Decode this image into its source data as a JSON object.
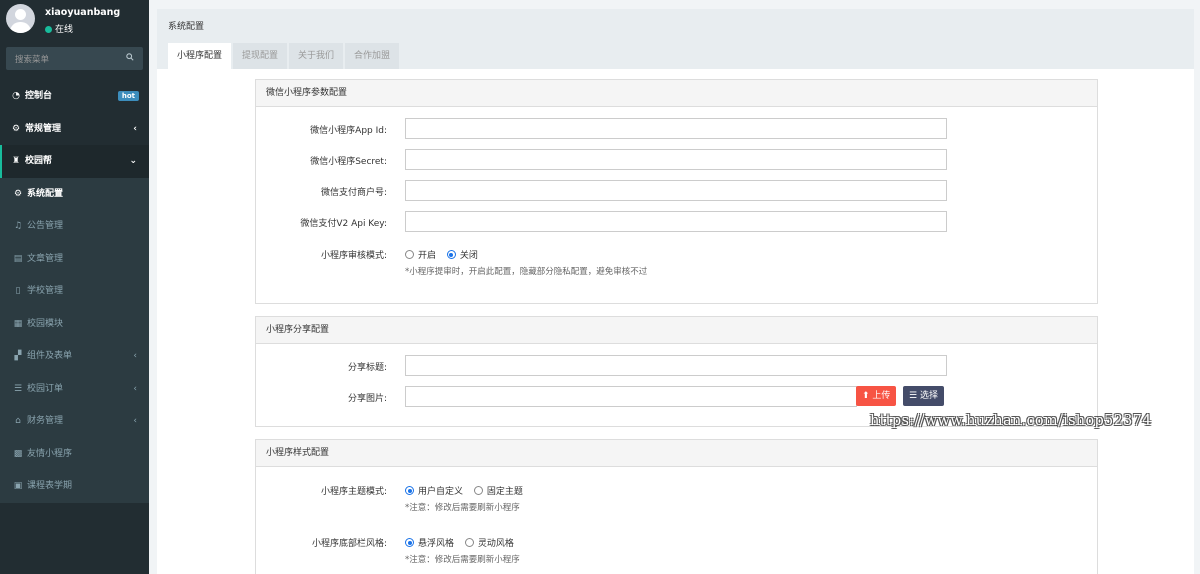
{
  "user": {
    "name": "xiaoyuanbang",
    "status": "在线"
  },
  "search": {
    "placeholder": "搜索菜单"
  },
  "menu": [
    {
      "label": "控制台",
      "icon": "dashboard-icon",
      "badge": "hot"
    },
    {
      "label": "常规管理",
      "icon": "cogs-icon",
      "arrow": "‹"
    },
    {
      "label": "校园帮",
      "icon": "sitemap-icon",
      "arrow": "⌄"
    }
  ],
  "submenu": [
    {
      "label": "系统配置",
      "icon": "cogs-icon"
    },
    {
      "label": "公告管理",
      "icon": "bell-icon"
    },
    {
      "label": "文章管理",
      "icon": "list-alt-icon"
    },
    {
      "label": "学校管理",
      "icon": "book-icon"
    },
    {
      "label": "校园模块",
      "icon": "th-icon"
    },
    {
      "label": "组件及表单",
      "icon": "puzzle-icon",
      "arrow": "‹"
    },
    {
      "label": "校园订单",
      "icon": "list-icon",
      "arrow": "‹"
    },
    {
      "label": "财务管理",
      "icon": "bank-icon",
      "arrow": "‹"
    },
    {
      "label": "友情小程序",
      "icon": "th-large-icon"
    },
    {
      "label": "课程表学期",
      "icon": "calendar-icon"
    }
  ],
  "page": {
    "title": "系统配置"
  },
  "tabs": [
    "小程序配置",
    "提现配置",
    "关于我们",
    "合作加盟"
  ],
  "section1": {
    "title": "微信小程序参数配置",
    "fields": [
      {
        "label": "微信小程序App Id:",
        "value": ""
      },
      {
        "label": "微信小程序Secret:",
        "value": ""
      },
      {
        "label": "微信支付商户号:",
        "value": ""
      },
      {
        "label": "微信支付V2 Api Key:",
        "value": ""
      }
    ],
    "review": {
      "label": "小程序审核模式:",
      "options": [
        "开启",
        "关闭"
      ],
      "selected": "关闭",
      "hint": "*小程序提审时，开启此配置，隐藏部分隐私配置，避免审核不过"
    }
  },
  "section2": {
    "title": "小程序分享配置",
    "share_title_label": "分享标题:",
    "share_title_value": "",
    "share_image_label": "分享图片:",
    "share_image_value": "",
    "upload_label": "上传",
    "choose_label": "选择"
  },
  "section3": {
    "title": "小程序样式配置",
    "theme": {
      "label": "小程序主题模式:",
      "options": [
        "用户自定义",
        "固定主题"
      ],
      "selected": "用户自定义",
      "hint": "*注意：修改后需要刷新小程序"
    },
    "tabbar": {
      "label": "小程序底部栏风格:",
      "options": [
        "悬浮风格",
        "灵动风格"
      ],
      "selected": "悬浮风格",
      "hint": "*注意：修改后需要刷新小程序"
    }
  },
  "watermark": "https://www.huzhan.com/ishop52374",
  "colors": {
    "sidebar": "#222d32",
    "accent": "#18bc9c",
    "upload": "#f75444",
    "choose": "#444c69",
    "radio": "#1a73e8"
  }
}
